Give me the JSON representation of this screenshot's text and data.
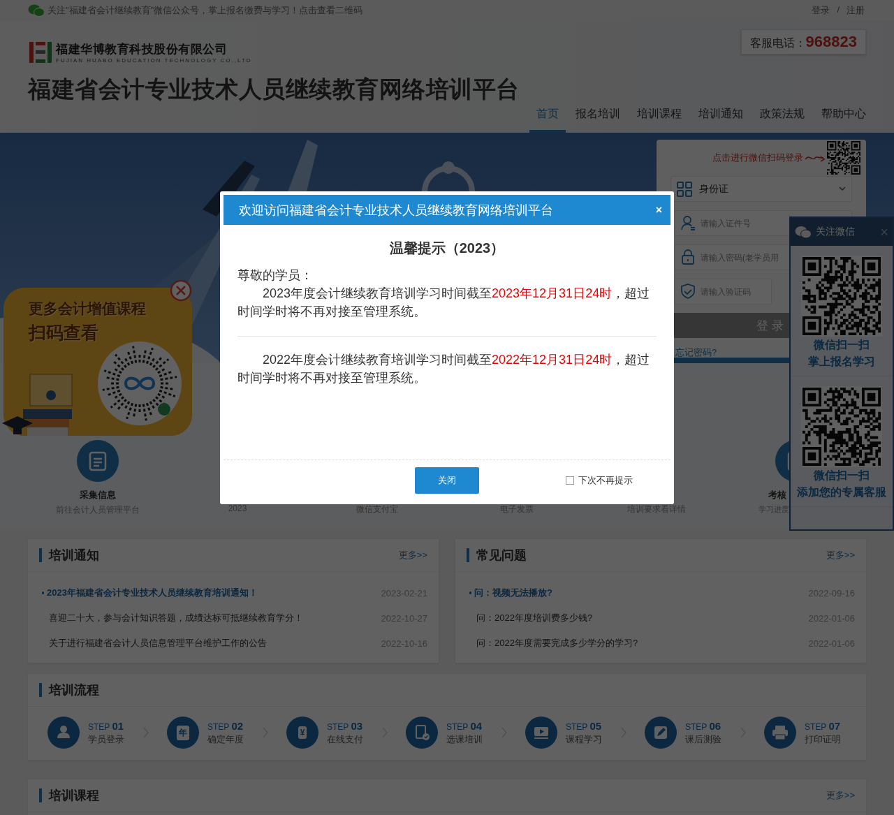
{
  "top_bar": {
    "notice": "关注\"福建省会计继续教育\"微信公众号，掌上报名缴费与学习！点击查看二维码",
    "login": "登录",
    "separator": "/",
    "register": "注册"
  },
  "header": {
    "company_name": "福建华博教育科技股份有限公司",
    "company_name_en": "FUJIAN HUABO EDUCATION TECHNOLOGY CO.,LTD",
    "site_title": "福建省会计专业技术人员继续教育网络培训平台",
    "hotline_label": "客服电话：",
    "hotline": "968823"
  },
  "nav": [
    {
      "label": "首页",
      "selected": true
    },
    {
      "label": "报名培训",
      "selected": false
    },
    {
      "label": "培训课程",
      "selected": false
    },
    {
      "label": "培训通知",
      "selected": false
    },
    {
      "label": "政策法规",
      "selected": false
    },
    {
      "label": "帮助中心",
      "selected": false
    }
  ],
  "login_box": {
    "wechat_login": "点击进行微信扫码登录",
    "id_type": "身份证",
    "id_placeholder": "请输入证件号",
    "password_placeholder": "请输入密码(老学员用",
    "captcha_placeholder": "请输入验证码",
    "login_button": "登 录",
    "forgot_password": "忘记密码?"
  },
  "features": [
    {
      "title": "采集信息",
      "subtitle": "前往会计人员管理平台"
    },
    {
      "subtitle": "2023"
    },
    {
      "subtitle": "微信支付宝"
    },
    {
      "subtitle": "电子发票"
    },
    {
      "subtitle": "培训要求看详情"
    },
    {
      "title": "考核",
      "subtitle": "学习进度"
    }
  ],
  "qr_popup": {
    "line1": "更多会计增值课程",
    "line2": "扫码查看"
  },
  "wechat_panel": {
    "title": "关注微信",
    "close": "×",
    "items": [
      {
        "line1": "微信扫一扫",
        "line2": "掌上报名学习"
      },
      {
        "line1": "微信扫一扫",
        "line2": "添加您的专属客服"
      }
    ]
  },
  "notices": {
    "title": "培训通知",
    "more": "更多>>",
    "items": [
      {
        "text": "2023年福建省会计专业技术人员继续教育培训通知！",
        "date": "2023-02-21",
        "highlight": true
      },
      {
        "text": "喜迎二十大，参与会计知识答题，成绩达标可抵继续教育学分！",
        "date": "2022-10-27",
        "highlight": false
      },
      {
        "text": "关于进行福建省会计人员信息管理平台维护工作的公告",
        "date": "2022-10-16",
        "highlight": false
      }
    ]
  },
  "faq": {
    "title": "常见问题",
    "more": "更多>>",
    "items": [
      {
        "text": "问：视频无法播放?",
        "date": "2022-09-16",
        "highlight": true
      },
      {
        "text": "问：2022年度培训费多少钱?",
        "date": "2022-01-06",
        "highlight": false
      },
      {
        "text": "问：2022年度需要完成多少学分的学习?",
        "date": "2022-01-06",
        "highlight": false
      }
    ]
  },
  "process": {
    "title": "培训流程",
    "steps": [
      {
        "step": "STEP **01**",
        "label": "学员登录"
      },
      {
        "step": "STEP **02**",
        "label": "确定年度",
        "glyph": "年"
      },
      {
        "step": "STEP **03**",
        "label": "在线支付",
        "glyph": "¥"
      },
      {
        "step": "STEP **04**",
        "label": "选课培训"
      },
      {
        "step": "STEP **05**",
        "label": "课程学习"
      },
      {
        "step": "STEP **06**",
        "label": "课后测验"
      },
      {
        "step": "STEP **07**",
        "label": "打印证明"
      }
    ]
  },
  "courses": {
    "title": "培训课程",
    "more": "更多>>"
  },
  "modal": {
    "title": "欢迎访问福建省会计专业技术人员继续教育网络培训平台",
    "close": "×",
    "heading": "温馨提示（2023）",
    "greeting": "尊敬的学员：",
    "paragraphs": [
      {
        "before": "2023年度会计继续教育培训学习时间截至",
        "deadline": "2023年12月31日24时",
        "after": "，超过时间学时将不再对接至管理系统。"
      },
      {
        "before": "2022年度会计继续教育培训学习时间截至",
        "deadline": "2022年12月31日24时",
        "after": "，超过时间学时将不再对接至管理系统。"
      }
    ],
    "close_button": "关闭",
    "dont_show": {
      "label": "下次不再提示",
      "checked": false
    }
  }
}
